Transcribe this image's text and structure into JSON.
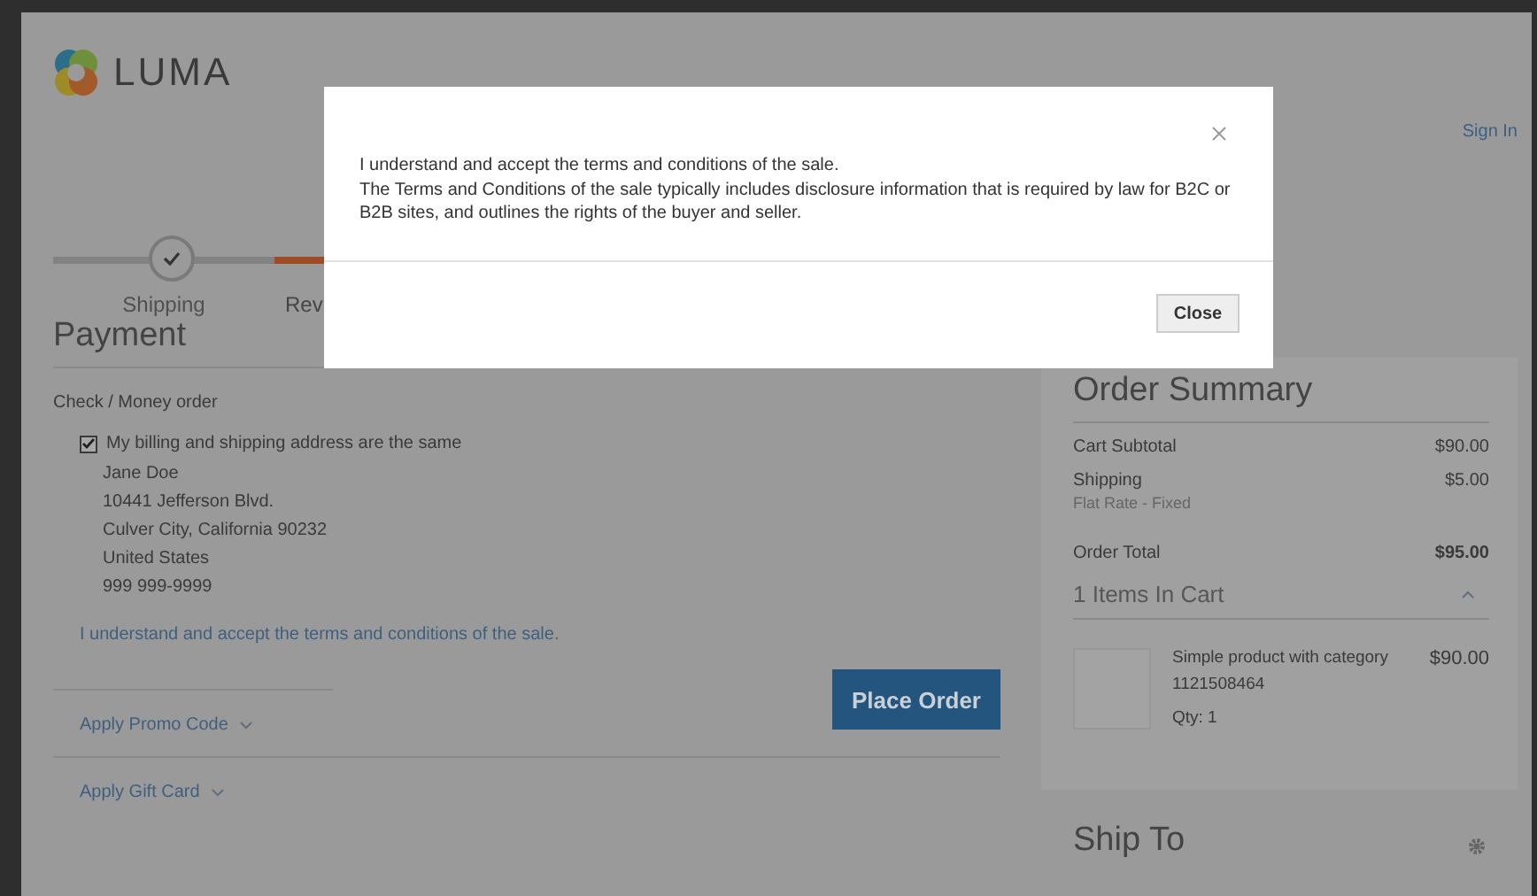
{
  "header": {
    "logo_text": "LUMA",
    "sign_in": "Sign In"
  },
  "progress": {
    "steps": [
      {
        "label": "Shipping",
        "completed": true,
        "selected": false
      },
      {
        "label": "Rev",
        "completed": false,
        "selected": true
      }
    ]
  },
  "payment": {
    "title": "Payment",
    "method": "Check / Money order",
    "same_address": {
      "label": "My billing and shipping address are the same",
      "checked": true
    },
    "address": [
      "Jane Doe",
      "10441 Jefferson Blvd.",
      "Culver City, California 90232",
      "United States",
      "999 999-9999"
    ],
    "terms_link": "I understand and accept the terms and conditions of the sale.",
    "place_order": "Place Order"
  },
  "discounts": [
    {
      "label": "Apply Promo Code",
      "expanded": false
    },
    {
      "label": "Apply Gift Card",
      "expanded": false
    }
  ],
  "summary": {
    "title": "Order Summary",
    "rows": [
      {
        "kind": "line",
        "label": "Cart Subtotal",
        "value": "$90.00"
      },
      {
        "kind": "line",
        "label": "Shipping",
        "note": "Flat Rate - Fixed",
        "value": "$5.00"
      },
      {
        "kind": "total",
        "label": "Order Total",
        "value": "$95.00"
      }
    ],
    "cart": {
      "title": "1 Items In Cart",
      "expanded": true,
      "items": [
        {
          "name": "Simple product with category",
          "sku": "1121508464",
          "qty": "Qty: 1",
          "price": "$90.00"
        }
      ]
    }
  },
  "ship_to": {
    "title": "Ship To"
  },
  "modal": {
    "paragraphs": [
      "I understand and accept the terms and conditions of the sale.",
      "The Terms and Conditions of the sale typically includes disclosure information that is required by law for B2C or B2B sites, and outlines the rights of the buyer and seller."
    ],
    "close_button": "Close"
  }
}
